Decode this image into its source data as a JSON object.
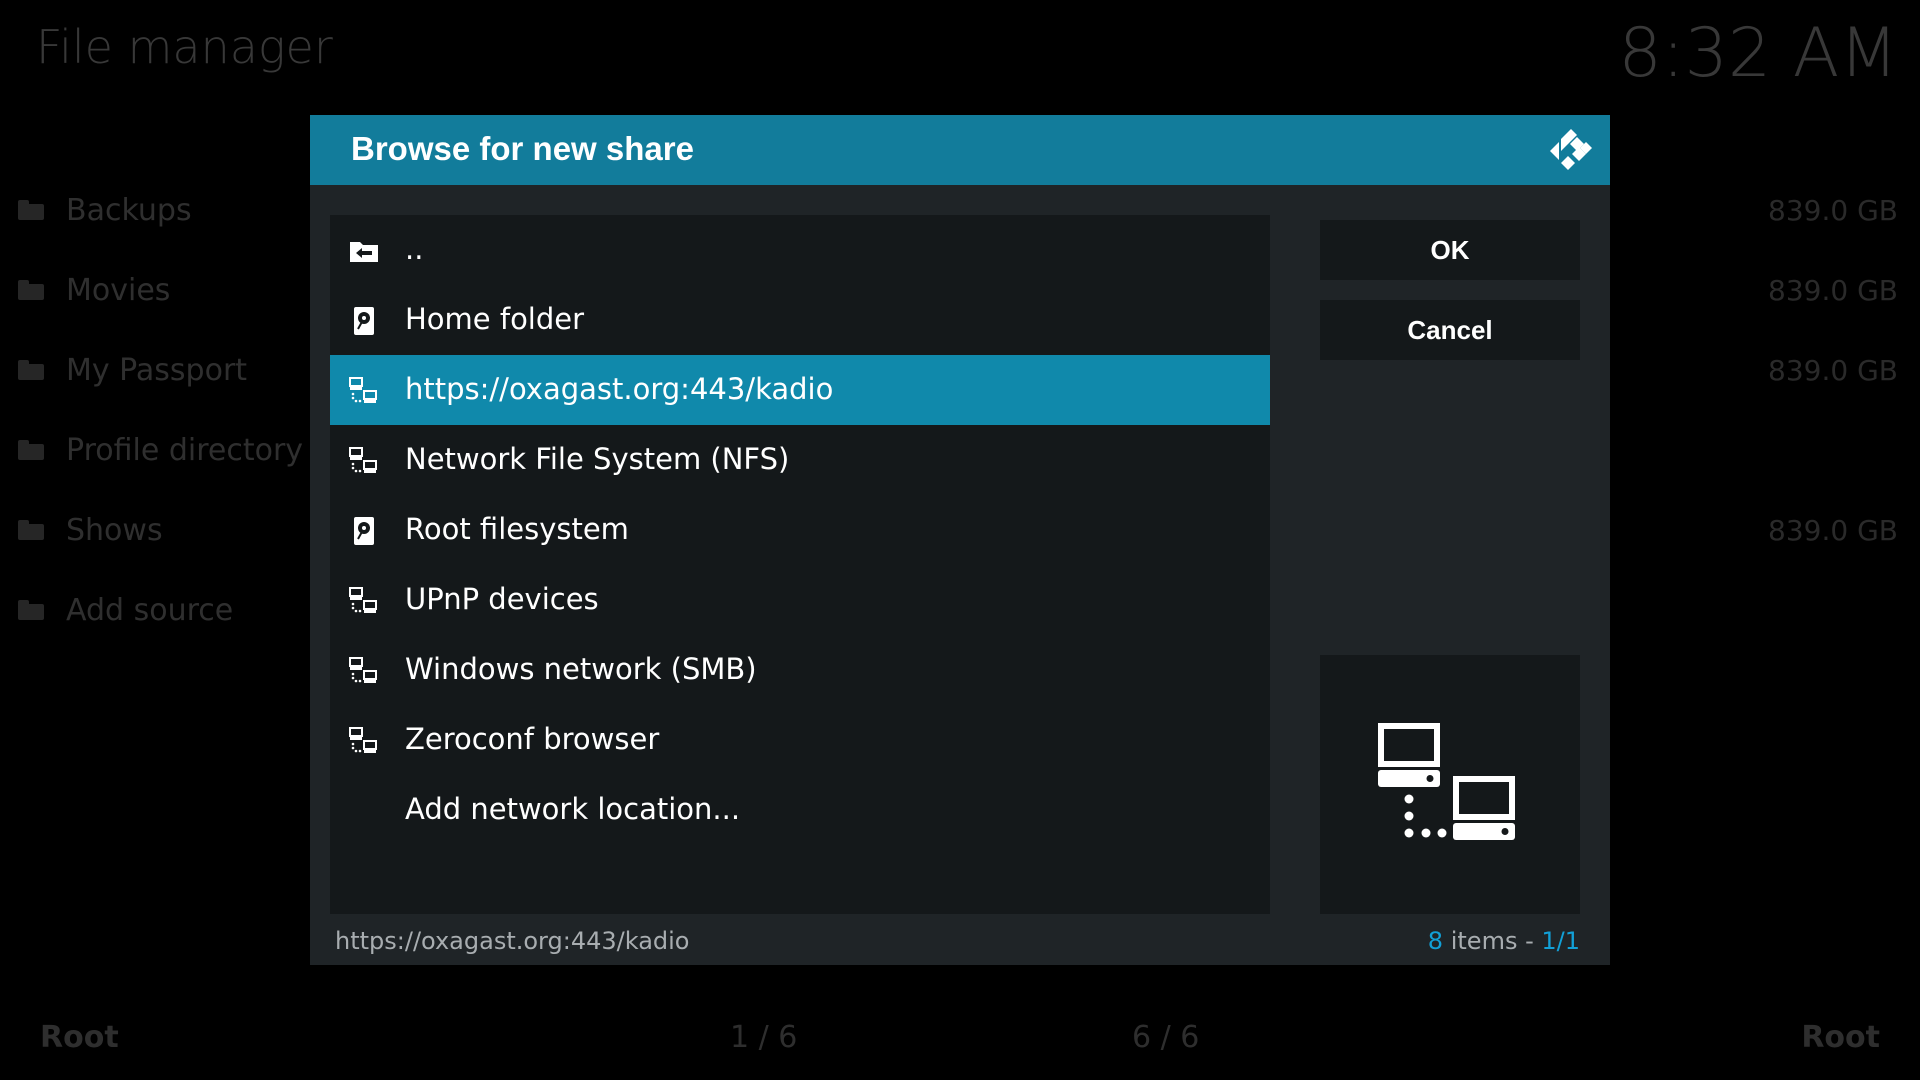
{
  "background": {
    "title": "File manager",
    "clock": "8:32 AM",
    "items": [
      {
        "label": "Backups",
        "size": "839.0 GB"
      },
      {
        "label": "Movies",
        "size": "839.0 GB"
      },
      {
        "label": "My Passport",
        "size": "839.0 GB"
      },
      {
        "label": "Profile directory",
        "size": ""
      },
      {
        "label": "Shows",
        "size": "839.0 GB"
      },
      {
        "label": "Add source",
        "size": ""
      }
    ],
    "footer": {
      "left_label": "Root",
      "left_count": "1 / 6",
      "right_count": "6 / 6",
      "right_label": "Root"
    }
  },
  "dialog": {
    "title": "Browse for new share",
    "logo": "kodi-logo-icon",
    "items": [
      {
        "label": "..",
        "icon": "folder-back-icon"
      },
      {
        "label": "Home folder",
        "icon": "hard-drive-icon"
      },
      {
        "label": "https://oxagast.org:443/kadio",
        "icon": "network-icon",
        "selected": true
      },
      {
        "label": "Network File System (NFS)",
        "icon": "network-icon"
      },
      {
        "label": "Root filesystem",
        "icon": "hard-drive-icon"
      },
      {
        "label": "UPnP devices",
        "icon": "network-icon"
      },
      {
        "label": "Windows network (SMB)",
        "icon": "network-icon"
      },
      {
        "label": "Zeroconf browser",
        "icon": "network-icon"
      },
      {
        "label": "Add network location...",
        "icon": ""
      }
    ],
    "buttons": {
      "ok": "OK",
      "cancel": "Cancel"
    },
    "preview_icon": "network-computers-icon",
    "footer": {
      "path": "https://oxagast.org:443/kadio",
      "item_count": "8",
      "items_word": "items -",
      "page": "1/1"
    },
    "colors": {
      "accent": "#12a0d7",
      "header": "#127c9b",
      "selection": "#1089ab"
    }
  }
}
